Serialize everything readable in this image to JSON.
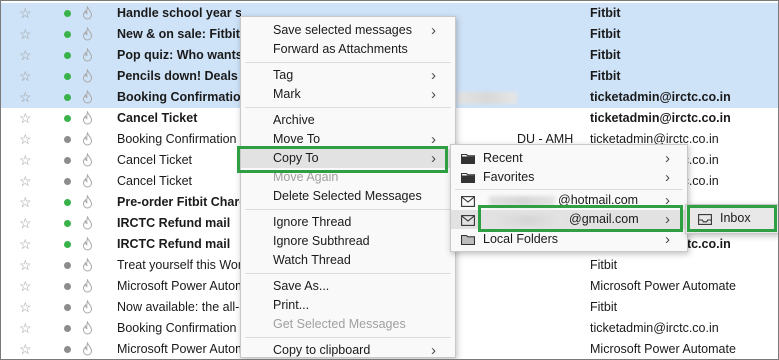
{
  "messages": [
    {
      "subject": "Handle school year stress with Sense",
      "sender": "Fitbit",
      "bold": true,
      "selected": true,
      "unread": true
    },
    {
      "subject": "New & on sale: Fitbit",
      "sender": "Fitbit",
      "bold": true,
      "selected": true,
      "unread": true
    },
    {
      "subject": "Pop quiz: Who wants",
      "sender": "Fitbit",
      "bold": true,
      "selected": true,
      "unread": true
    },
    {
      "subject": "Pencils down! Deals u",
      "sender": "Fitbit",
      "bold": true,
      "selected": true,
      "unread": true
    },
    {
      "subject": "Booking Confirmation",
      "sender": "ticketadmin@irctc.co.in",
      "bold": true,
      "selected": true,
      "unread": true
    },
    {
      "subject": "Cancel Ticket",
      "sender": "ticketadmin@irctc.co.in",
      "bold": true,
      "selected": false,
      "unread": true
    },
    {
      "subject": "Booking Confirmation o",
      "sender": "ticketadmin@irctc.co.in",
      "bold": false,
      "selected": false,
      "unread": false,
      "extra": "DU - AMH"
    },
    {
      "subject": "Cancel Ticket",
      "sender": "ticketadmin@irctc.co.in",
      "bold": false,
      "selected": false,
      "unread": false
    },
    {
      "subject": "Cancel Ticket",
      "sender": "ticketadmin@irctc.co.in",
      "bold": false,
      "selected": false,
      "unread": false
    },
    {
      "subject": "Pre-order Fitbit Charg",
      "sender": "Fitbit",
      "bold": true,
      "selected": false,
      "unread": true
    },
    {
      "subject": "IRCTC Refund mail",
      "sender": "ticketadmin@irctc.co.in",
      "bold": true,
      "selected": false,
      "unread": true
    },
    {
      "subject": "IRCTC Refund mail",
      "sender": "ticketadmin@irctc.co.in",
      "bold": true,
      "selected": false,
      "unread": true
    },
    {
      "subject": "Treat yourself this Worl",
      "sender": "Fitbit",
      "bold": false,
      "selected": false,
      "unread": false
    },
    {
      "subject": "Microsoft Power Autom",
      "sender": "Microsoft Power Automate",
      "bold": false,
      "selected": false,
      "unread": false
    },
    {
      "subject": "Now available: the all-r",
      "sender": "Fitbit",
      "bold": false,
      "selected": false,
      "unread": false
    },
    {
      "subject": "Booking Confirmation o",
      "sender": "ticketadmin@irctc.co.in",
      "bold": false,
      "selected": false,
      "unread": false
    },
    {
      "subject": "Microsoft Power Automate - October Newsletter",
      "sender": "Microsoft Power Automate",
      "bold": false,
      "selected": false,
      "unread": false
    }
  ],
  "context_menu": [
    {
      "label": "Save selected messages",
      "arrow": true
    },
    {
      "label": "Forward as Attachments"
    },
    {
      "sep": true
    },
    {
      "label": "Tag",
      "arrow": true
    },
    {
      "label": "Mark",
      "arrow": true
    },
    {
      "sep": true
    },
    {
      "label": "Archive"
    },
    {
      "label": "Move To",
      "arrow": true
    },
    {
      "label": "Copy To",
      "arrow": true,
      "hover": true
    },
    {
      "label": "Move Again",
      "disabled": true
    },
    {
      "label": "Delete Selected Messages"
    },
    {
      "sep": true
    },
    {
      "label": "Ignore Thread"
    },
    {
      "label": "Ignore Subthread"
    },
    {
      "label": "Watch Thread"
    },
    {
      "sep": true
    },
    {
      "label": "Save As..."
    },
    {
      "label": "Print..."
    },
    {
      "label": "Get Selected Messages",
      "disabled": true
    },
    {
      "sep": true
    },
    {
      "label": "Copy to clipboard",
      "arrow": true
    }
  ],
  "copy_to_menu": {
    "recent": "Recent",
    "favorites": "Favorites",
    "hotmail": "@hotmail.com",
    "gmail": "@gmail.com",
    "local": "Local Folders"
  },
  "gmail_submenu": {
    "inbox": "Inbox"
  },
  "colors": {
    "selection": "#cfe3f8",
    "highlight": "#2ea043",
    "unread_dot": "#38b249"
  }
}
